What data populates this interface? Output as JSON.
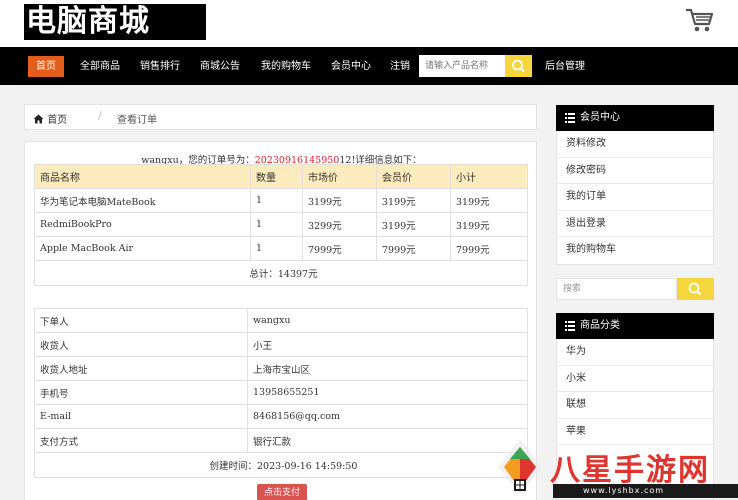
{
  "header": {
    "logo": "电脑商城",
    "cart_icon": "shopping-cart-icon"
  },
  "nav": {
    "items": [
      "首页",
      "全部商品",
      "销售排行",
      "商城公告",
      "我的购物车",
      "会员中心",
      "注销"
    ],
    "active": "首页",
    "search_placeholder": "请输入产品名称",
    "search_icon": "search-icon",
    "admin": "后台管理"
  },
  "breadcrumb": {
    "home": "首页",
    "separator": "/",
    "current": "查看订单"
  },
  "order": {
    "user": "wangxu",
    "msg_pre": "，您的订单号为：",
    "number": "20230916145950",
    "msg_post": "12!详细信息如下：",
    "columns": [
      "商品名称",
      "数量",
      "市场价",
      "会员价",
      "小计"
    ],
    "rows": [
      [
        "华为笔记本电脑MateBook",
        "1",
        "3199元",
        "3199元",
        "3199元"
      ],
      [
        "RedmiBookPro",
        "1",
        "3299元",
        "3199元",
        "3199元"
      ],
      [
        "Apple MacBook Air",
        "1",
        "7999元",
        "7999元",
        "7999元"
      ]
    ],
    "total": "总计：14397元"
  },
  "info": {
    "rows": [
      [
        "下单人",
        "wangxu"
      ],
      [
        "收货人",
        "小王"
      ],
      [
        "收货人地址",
        "上海市宝山区"
      ],
      [
        "手机号",
        "13958655251"
      ],
      [
        "E-mail",
        "8468156@qq.com"
      ],
      [
        "支付方式",
        "银行汇款"
      ]
    ],
    "created": "创建时间：2023-09-16 14:59:50",
    "pay_button": "点击支付"
  },
  "sidebar": {
    "member_title": "会员中心",
    "member_items": [
      "资料修改",
      "修改密码",
      "我的订单",
      "退出登录",
      "我的购物车"
    ],
    "search_placeholder": "搜索",
    "category_title": "商品分类",
    "category_items": [
      "华为",
      "小米",
      "联想",
      "苹果"
    ]
  },
  "watermark": {
    "text": "八星手游网",
    "url": "www.lyshbx.com"
  },
  "colors": {
    "accent": "#e45d1a",
    "search_button": "#f5d63d",
    "table_header": "#fcebbd",
    "order_number": "#d8232a",
    "pay_button": "#d9534f"
  }
}
